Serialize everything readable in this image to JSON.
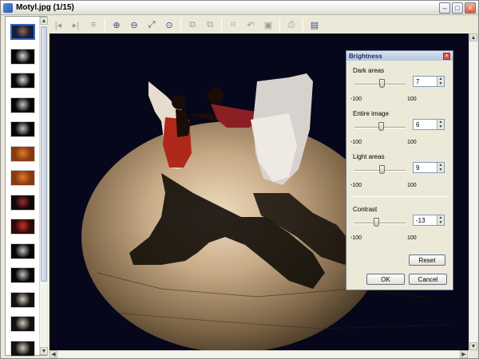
{
  "window": {
    "title": "Motyl.jpg (1/15)"
  },
  "titlebar_buttons": [
    "minimize-icon",
    "maximize-icon",
    "close-icon"
  ],
  "toolbar": {
    "tools": [
      {
        "name": "first-image-icon",
        "glyph": "|◂",
        "enabled": false
      },
      {
        "name": "next-image-icon",
        "glyph": "▸|",
        "enabled": false
      },
      {
        "name": "list-icon",
        "glyph": "≡",
        "enabled": false
      },
      {
        "name": "zoom-in-icon",
        "glyph": "⊕",
        "enabled": true
      },
      {
        "name": "zoom-out-icon",
        "glyph": "⊖",
        "enabled": true
      },
      {
        "name": "fit-window-icon",
        "glyph": "⤢",
        "enabled": true
      },
      {
        "name": "actual-size-icon",
        "glyph": "⊙",
        "enabled": true
      },
      {
        "name": "copy-icon",
        "glyph": "⧉",
        "enabled": false
      },
      {
        "name": "paste-icon",
        "glyph": "⧉",
        "enabled": false
      },
      {
        "name": "crop-icon",
        "glyph": "⌗",
        "enabled": false
      },
      {
        "name": "undo-icon",
        "glyph": "↶",
        "enabled": false
      },
      {
        "name": "save-icon",
        "glyph": "▣",
        "enabled": false
      },
      {
        "name": "print-icon",
        "glyph": "⎙",
        "enabled": false
      },
      {
        "name": "slideshow-icon",
        "glyph": "▤",
        "enabled": true
      }
    ]
  },
  "dialog": {
    "title": "Brightness",
    "sliders": [
      {
        "label": "Dark areas",
        "value": "7",
        "fill": 0.535,
        "min_label": "-100",
        "max_label": "100"
      },
      {
        "label": "Entire image",
        "value": "6",
        "fill": 0.53,
        "min_label": "-100",
        "max_label": "100"
      },
      {
        "label": "Light areas",
        "value": "9",
        "fill": 0.545,
        "min_label": "-100",
        "max_label": "100"
      },
      {
        "label": "Contrast",
        "value": "-13",
        "fill": 0.435,
        "min_label": "-100",
        "max_label": "100"
      }
    ],
    "reset_label": "Reset",
    "ok_label": "OK",
    "cancel_label": "Cancel"
  },
  "thumbnails": [
    {
      "colors": [
        "#1b1b3a",
        "#8a6a4a"
      ]
    },
    {
      "colors": [
        "#050505",
        "#d7d7d7"
      ]
    },
    {
      "colors": [
        "#050505",
        "#d7d7d7"
      ]
    },
    {
      "colors": [
        "#050505",
        "#c0c0c0"
      ]
    },
    {
      "colors": [
        "#050505",
        "#c0c0c0"
      ]
    },
    {
      "colors": [
        "#8a3a12",
        "#e07a24"
      ]
    },
    {
      "colors": [
        "#8a3a12",
        "#e07a24"
      ]
    },
    {
      "colors": [
        "#100808",
        "#9d2a2a"
      ]
    },
    {
      "colors": [
        "#300808",
        "#c8322a"
      ]
    },
    {
      "colors": [
        "#050505",
        "#c0c0c0"
      ]
    },
    {
      "colors": [
        "#050505",
        "#c0c0c0"
      ]
    },
    {
      "colors": [
        "#101010",
        "#d0c8b8"
      ]
    },
    {
      "colors": [
        "#101010",
        "#d0c8b8"
      ]
    },
    {
      "colors": [
        "#101010",
        "#d0c8b8"
      ]
    }
  ]
}
